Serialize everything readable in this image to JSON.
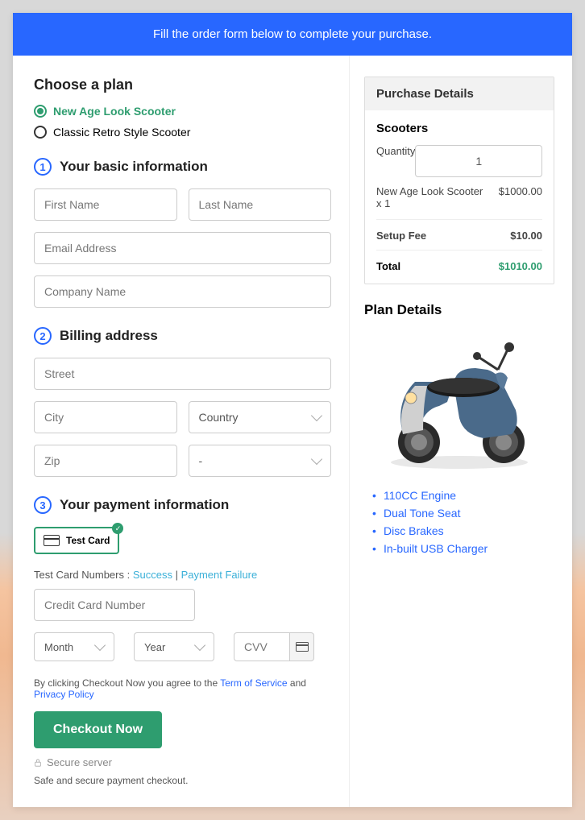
{
  "banner": "Fill the order form below to complete your purchase.",
  "plan": {
    "title": "Choose a plan",
    "options": [
      "New Age Look Scooter",
      "Classic Retro Style Scooter"
    ]
  },
  "section1": {
    "num": "1",
    "title": "Your basic information",
    "first_name": "First Name",
    "last_name": "Last Name",
    "email": "Email Address",
    "company": "Company Name"
  },
  "section2": {
    "num": "2",
    "title": "Billing address",
    "street": "Street",
    "city": "City",
    "country": "Country",
    "zip": "Zip",
    "state": "-"
  },
  "section3": {
    "num": "3",
    "title": "Your payment information",
    "test_card": "Test Card",
    "test_prefix": "Test Card Numbers : ",
    "success": "Success",
    "sep": " | ",
    "failure": "Payment Failure",
    "cc": "Credit Card Number",
    "month": "Month",
    "year": "Year",
    "cvv": "CVV"
  },
  "terms": {
    "prefix": "By clicking Checkout Now you agree to the ",
    "tos": "Term of Service",
    "and": " and ",
    "pp": "Privacy Policy"
  },
  "checkout": "Checkout Now",
  "secure": "Secure server",
  "safe_note": "Safe and secure payment checkout.",
  "purchase": {
    "heading": "Purchase Details",
    "scooters": "Scooters",
    "quantity_label": "Quantity",
    "quantity": "1",
    "item_name": "New Age Look Scooter x 1",
    "item_price": "$1000.00",
    "setup_label": "Setup Fee",
    "setup_price": "$10.00",
    "total_label": "Total",
    "total_price": "$1010.00"
  },
  "plan_details": {
    "title": "Plan Details",
    "features": [
      "110CC Engine",
      "Dual Tone Seat",
      "Disc Brakes",
      "In-built USB Charger"
    ]
  }
}
